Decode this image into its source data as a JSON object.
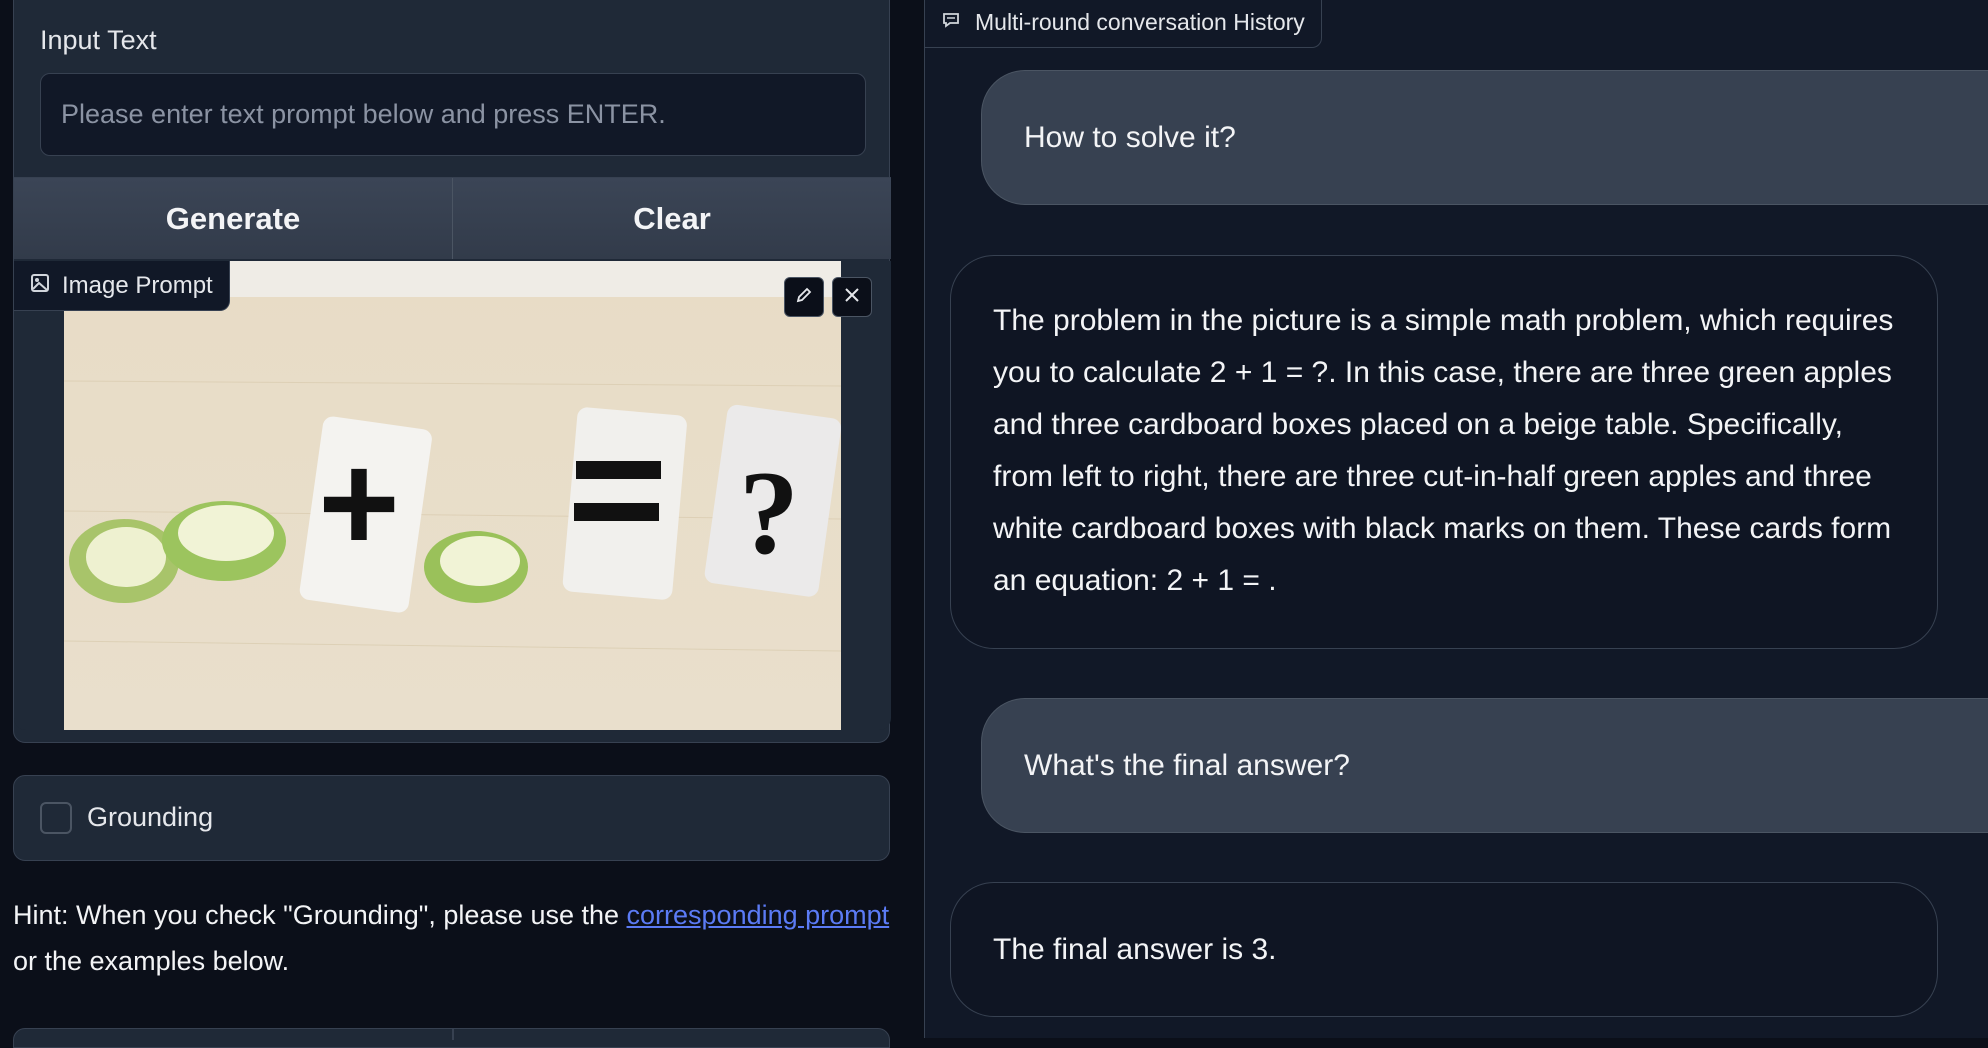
{
  "input": {
    "label": "Input Text",
    "placeholder": "Please enter text prompt below and press ENTER."
  },
  "buttons": {
    "generate": "Generate",
    "clear": "Clear"
  },
  "image_prompt": {
    "label": "Image Prompt"
  },
  "grounding": {
    "label": "Grounding",
    "checked": false
  },
  "hint": {
    "prefix": "Hint: When you check \"Grounding\", please use the ",
    "link": "corresponding prompt",
    "suffix": " or the examples below."
  },
  "history": {
    "title": "Multi-round conversation History",
    "messages": [
      {
        "role": "user",
        "text": "How to solve it?"
      },
      {
        "role": "assistant",
        "text": "The problem in the picture is a simple math problem, which requires you to calculate 2 + 1 = ?. In this case, there are three green apples and three cardboard boxes placed on a beige table. Specifically, from left to right, there are three cut-in-half green apples and three white cardboard boxes with black marks on them. These cards form an equation: 2 + 1 = ."
      },
      {
        "role": "user",
        "text": "What's the final answer?"
      },
      {
        "role": "assistant",
        "text": "The final answer is 3."
      }
    ]
  }
}
